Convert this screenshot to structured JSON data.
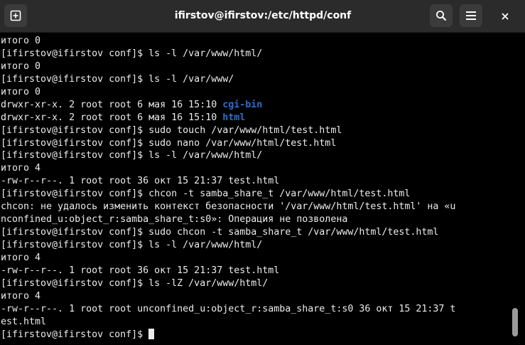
{
  "window": {
    "title": "ifirstov@ifirstov:/etc/httpd/conf",
    "icons": {
      "new_tab": "new-tab-icon",
      "search": "search-icon",
      "menu": "hamburger-menu-icon",
      "close": "close-icon"
    }
  },
  "colors": {
    "titlebar": "#2b2b2b",
    "terminal_bg": "#000000",
    "text": "#ececec",
    "directory": "#2a6fd1"
  },
  "terminal": {
    "lines": [
      [
        {
          "text": "итого 0"
        }
      ],
      [
        {
          "text": "[ifirstov@ifirstov conf]$ ls -l /var/www/html/"
        }
      ],
      [
        {
          "text": "итого 0"
        }
      ],
      [
        {
          "text": "[ifirstov@ifirstov conf]$ ls -l /var/www/"
        }
      ],
      [
        {
          "text": "итого 0"
        }
      ],
      [
        {
          "text": "drwxr-xr-x. 2 root root 6 мая 16 15:10 "
        },
        {
          "text": "cgi-bin",
          "style": "dir"
        }
      ],
      [
        {
          "text": "drwxr-xr-x. 2 root root 6 мая 16 15:10 "
        },
        {
          "text": "html",
          "style": "dir"
        }
      ],
      [
        {
          "text": "[ifirstov@ifirstov conf]$ sudo touch /var/www/html/test.html"
        }
      ],
      [
        {
          "text": "[ifirstov@ifirstov conf]$ sudo nano /var/www/html/test.html"
        }
      ],
      [
        {
          "text": "[ifirstov@ifirstov conf]$ ls -l /var/www/html/"
        }
      ],
      [
        {
          "text": "итого 4"
        }
      ],
      [
        {
          "text": "-rw-r--r--. 1 root root 36 окт 15 21:37 test.html"
        }
      ],
      [
        {
          "text": "[ifirstov@ifirstov conf]$ chcon -t samba_share_t /var/www/html/test.html"
        }
      ],
      [
        {
          "text": "chcon: не удалось изменить контекст безопасности '/var/www/html/test.html' на «u"
        }
      ],
      [
        {
          "text": "nconfined_u:object_r:samba_share_t:s0»: Операция не позволена"
        }
      ],
      [
        {
          "text": "[ifirstov@ifirstov conf]$ sudo chcon -t samba_share_t /var/www/html/test.html"
        }
      ],
      [
        {
          "text": "[ifirstov@ifirstov conf]$ ls -l /var/www/html/"
        }
      ],
      [
        {
          "text": "итого 4"
        }
      ],
      [
        {
          "text": "-rw-r--r--. 1 root root 36 окт 15 21:37 test.html"
        }
      ],
      [
        {
          "text": "[ifirstov@ifirstov conf]$ ls -lZ /var/www/html/"
        }
      ],
      [
        {
          "text": "итого 4"
        }
      ],
      [
        {
          "text": "-rw-r--r--. 1 root root unconfined_u:object_r:samba_share_t:s0 36 окт 15 21:37 t"
        }
      ],
      [
        {
          "text": "est.html"
        }
      ],
      [
        {
          "text": "[ifirstov@ifirstov conf]$ "
        }
      ]
    ]
  }
}
